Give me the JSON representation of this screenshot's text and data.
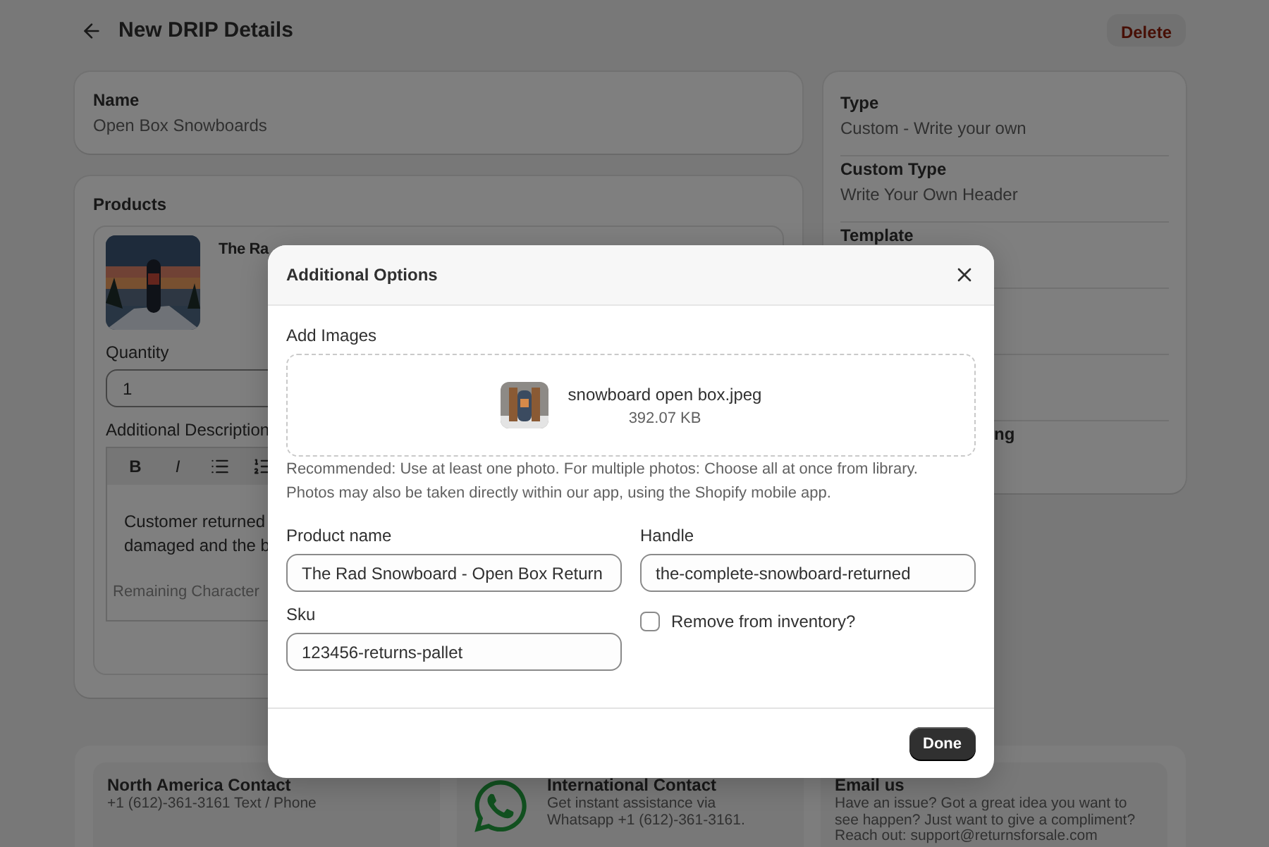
{
  "page": {
    "title": "New DRIP Details",
    "delete_button": "Delete"
  },
  "name_card": {
    "label": "Name",
    "value": "Open Box Snowboards"
  },
  "products_card": {
    "title": "Products",
    "product_title": "The Ra",
    "quantity_label": "Quantity",
    "quantity_value": "1",
    "description_label": "Additional Description",
    "toolbar": [
      {
        "kind": "bold",
        "label": "B"
      },
      {
        "kind": "italic",
        "label": "I"
      },
      {
        "kind": "bullets"
      },
      {
        "kind": "numbers"
      }
    ],
    "description": "Customer returned\ndamaged and the b",
    "remaining": "Remaining Character"
  },
  "details_card": {
    "rows": [
      {
        "label": "Type",
        "value": "Custom - Write your own"
      },
      {
        "label": "Custom Type",
        "value": "Write Your Own Header"
      },
      {
        "label": "Template"
      },
      {},
      {},
      {
        "label": "ng",
        "kind": "covered"
      }
    ]
  },
  "contacts": [
    {
      "kind": "plain",
      "title": "North America Contact",
      "text": "+1 (612)-361-3161 Text / Phone"
    },
    {
      "kind": "whatsapp",
      "title": "International Contact",
      "text": "Get instant assistance via\nWhatsapp +1 (612)-361-3161."
    },
    {
      "kind": "plain",
      "title": "Email us",
      "text": "Have an issue? Got a great idea you want to\nsee happen? Just want to give a compliment?\nReach out: support@returnsforsale.com"
    }
  ],
  "modal": {
    "title": "Additional Options",
    "images_label": "Add Images",
    "file": {
      "name": "snowboard open box.jpeg",
      "size": "392.07 KB"
    },
    "help": "Recommended: Use at least one photo. For multiple photos: Choose all at once from library.\nPhotos may also be taken directly within our app, using the Shopify mobile app.",
    "fields": [
      {
        "label": "Product name",
        "value": "The Rad Snowboard - Open Box Return"
      },
      {
        "label": "Handle",
        "value": "the-complete-snowboard-returned"
      },
      {
        "label": "Sku",
        "value": "123456-returns-pallet"
      }
    ],
    "remove_from_inventory": {
      "label": "Remove from inventory?",
      "checked": false
    },
    "done_button": "Done"
  }
}
